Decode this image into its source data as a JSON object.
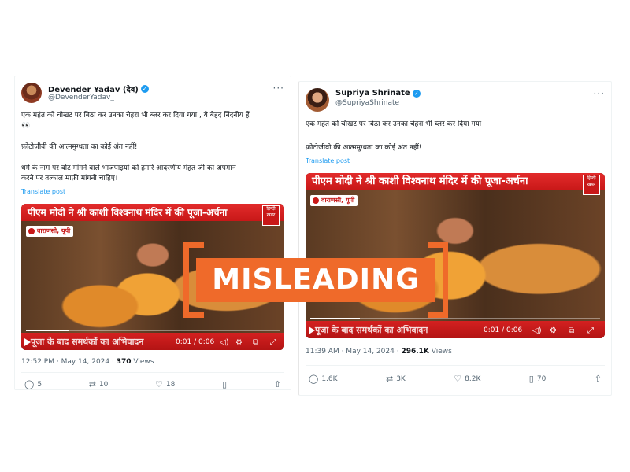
{
  "left_tweet": {
    "name": "Devender Yadav (देव)",
    "handle": "@DevenderYadav_",
    "text_line1": "एक महंत को चौखट पर बिठा कर उनका चेहरा भी ब्लर कर दिया गया , ये बेहद निंदनीय हैं",
    "text_line2": "👀",
    "text_line3": "फ़ोटोजीवी की आत्ममुग्धता का कोई अंत नहीं!",
    "text_line4": "धर्म के नाम पर वोट मांगने वाले भाजपाइयों को हमारे आदरणीय मंहत जी का अपमान",
    "text_line5": "करने पर तत्काल माफ़ी मांगनी चाहिए।",
    "translate": "Translate post",
    "video": {
      "banner": "पीएम मोदी ने श्री काशी विश्वनाथ मंदिर में की पूजा-अर्चना",
      "location": "वाराणसी, यूपी",
      "caption": "पूजा के बाद समर्थकों का अभिवादन",
      "time": "0:01 / 0:06",
      "progress": 0.17
    },
    "timestamp": "12:52 PM · May 14, 2024 · ",
    "views_count": "370",
    "views_label": " Views",
    "replies": "5",
    "reposts": "10",
    "likes": "18"
  },
  "right_tweet": {
    "name": "Supriya Shrinate",
    "handle": "@SupriyaShrinate",
    "text_line1": "एक महंत को चौखट पर बिठा कर उनका चेहरा भी ब्लर कर दिया गया",
    "text_line2": "फ़ोटोजीवी की आत्ममुग्धता का कोई अंत नहीं!",
    "translate": "Translate post",
    "video": {
      "banner": "पीएम मोदी ने श्री काशी विश्वनाथ मंदिर में की पूजा-अर्चना",
      "location": "वाराणसी, यूपी",
      "caption": "पूजा के बाद समर्थकों का अभिवादन",
      "time": "0:01 / 0:06",
      "progress": 0.17
    },
    "timestamp": "11:39 AM · May 14, 2024 · ",
    "views_count": "296.1K",
    "views_label": " Views",
    "replies": "1.6K",
    "reposts": "3K",
    "likes": "8.2K",
    "bookmarks": "70"
  },
  "channel_logo": "हिन्दी खबर",
  "stamp": {
    "label": "MISLEADING",
    "color": "#ef6a2a"
  },
  "colors": {
    "accent": "#1d9bf0",
    "banner": "#e22b2b"
  },
  "icons": [
    "verified-icon",
    "more-icon",
    "reply-icon",
    "repost-icon",
    "like-icon",
    "bookmark-icon",
    "share-icon",
    "play-icon",
    "volume-icon",
    "settings-icon",
    "fullscreen-icon"
  ]
}
